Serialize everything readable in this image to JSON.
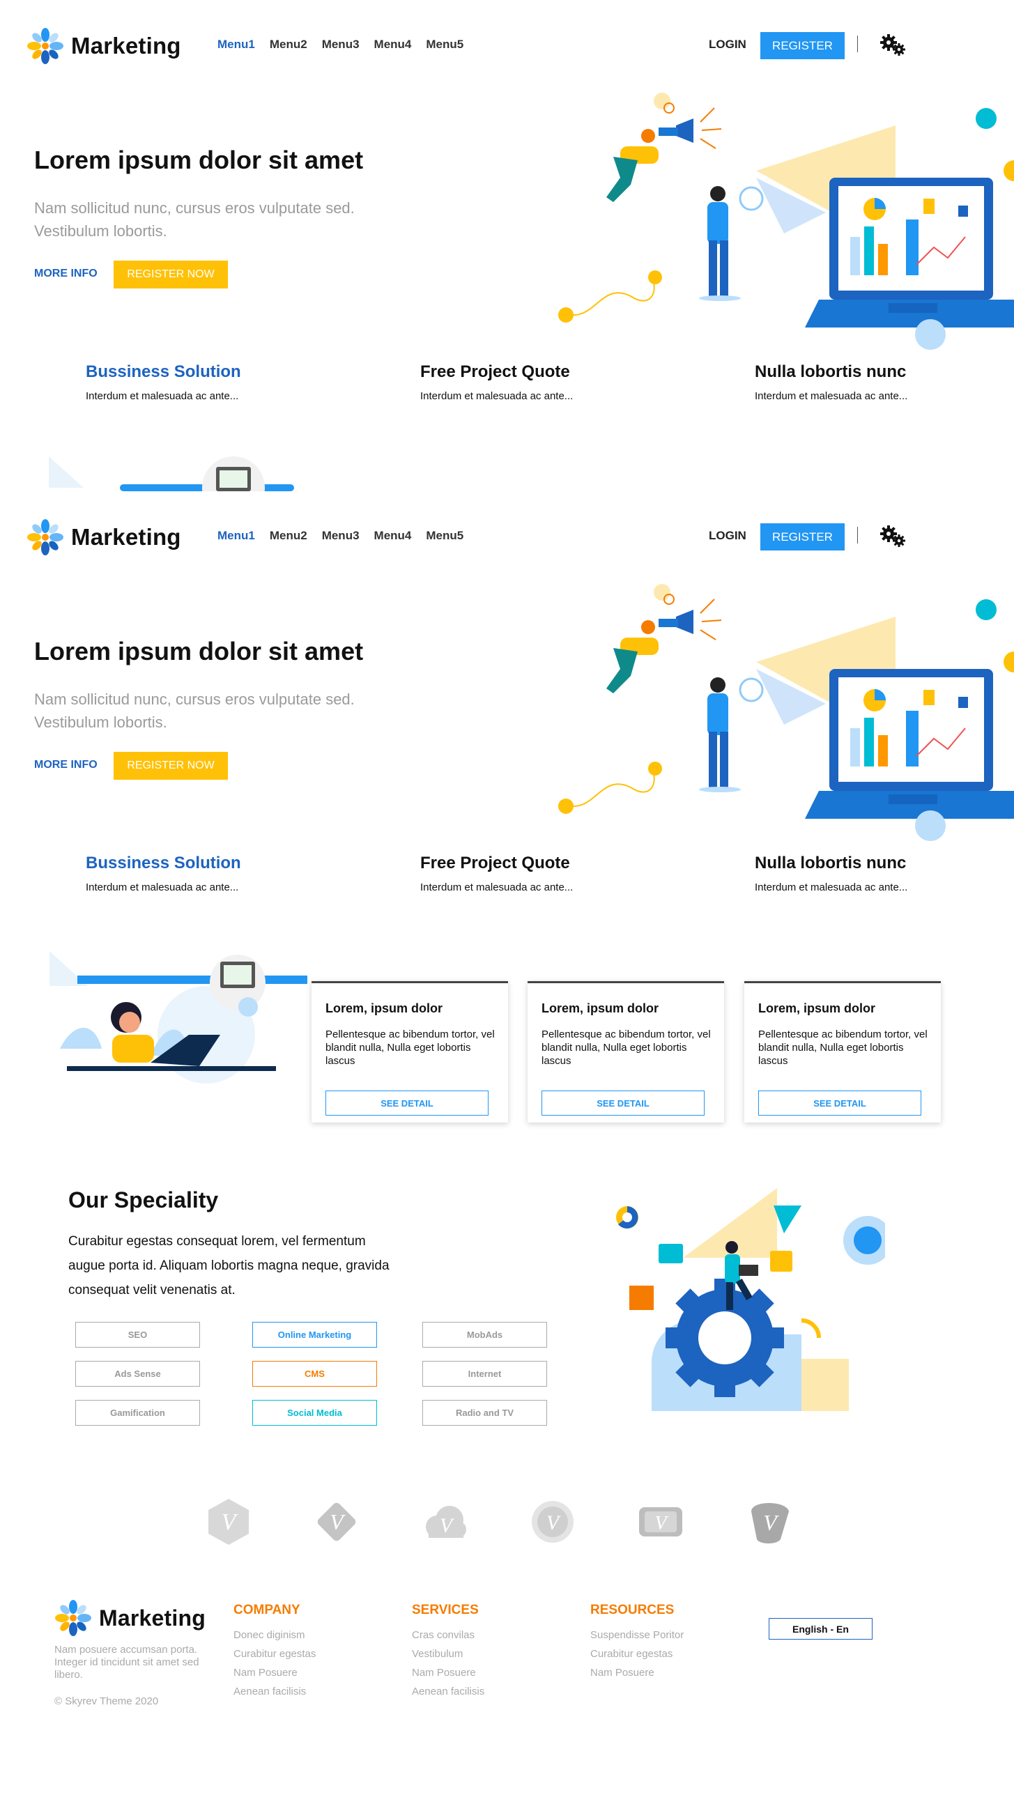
{
  "brand": {
    "name": "Marketing"
  },
  "nav": {
    "items": [
      "Menu1",
      "Menu2",
      "Menu3",
      "Menu4",
      "Menu5"
    ],
    "active_index": 0
  },
  "auth": {
    "login": "LOGIN",
    "register": "REGISTER"
  },
  "hero": {
    "title": "Lorem ipsum dolor sit amet",
    "subtitle": "Nam sollicitud nunc, cursus eros vulputate sed. Vestibulum lobortis.",
    "more_info": "MORE INFO",
    "register_now": "REGISTER NOW"
  },
  "features": [
    {
      "title": "Bussiness Solution",
      "text": "Interdum et malesuada ac ante..."
    },
    {
      "title": "Free Project Quote",
      "text": "Interdum et malesuada ac ante..."
    },
    {
      "title": "Nulla lobortis nunc",
      "text": "Interdum et malesuada ac ante..."
    }
  ],
  "cards": [
    {
      "title": "Lorem, ipsum dolor",
      "text": "Pellentesque ac bibendum tortor, vel blandit nulla, Nulla eget lobortis lascus",
      "button": "SEE DETAIL"
    },
    {
      "title": "Lorem, ipsum dolor",
      "text": "Pellentesque ac bibendum tortor, vel blandit nulla, Nulla eget lobortis lascus",
      "button": "SEE DETAIL"
    },
    {
      "title": "Lorem, ipsum dolor",
      "text": "Pellentesque ac bibendum tortor, vel blandit nulla, Nulla eget lobortis lascus",
      "button": "SEE DETAIL"
    }
  ],
  "speciality": {
    "title": "Our Speciality",
    "text": "Curabitur egestas consequat lorem, vel fermentum augue porta id. Aliquam lobortis magna neque, gravida consequat velit venenatis at.",
    "tags": [
      "SEO",
      "Online Marketing",
      "MobAds",
      "Ads Sense",
      "CMS",
      "Internet",
      "Gamification",
      "Social Media",
      "Radio and TV"
    ]
  },
  "partners": {
    "icon": "vimeo-logo-icon",
    "count": 6
  },
  "footer": {
    "description": "Nam posuere accumsan porta. Integer id tincidunt sit amet sed libero.",
    "copyright": "© Skyrev Theme 2020",
    "columns": [
      {
        "title": "COMPANY",
        "links": [
          "Donec diginism",
          "Curabitur egestas",
          "Nam Posuere",
          "Aenean facilisis"
        ]
      },
      {
        "title": "SERVICES",
        "links": [
          "Cras convilas",
          "Vestibulum",
          "Nam Posuere",
          "Aenean facilisis"
        ]
      },
      {
        "title": "RESOURCES",
        "links": [
          "Suspendisse Poritor",
          "Curabitur egestas",
          "Nam Posuere"
        ]
      }
    ],
    "language": "English - En"
  },
  "colors": {
    "primary": "#2196f3",
    "brand_blue": "#1d63c0",
    "accent_yellow": "#ffc107",
    "accent_orange": "#f57c00",
    "teal": "#00bcd4"
  }
}
